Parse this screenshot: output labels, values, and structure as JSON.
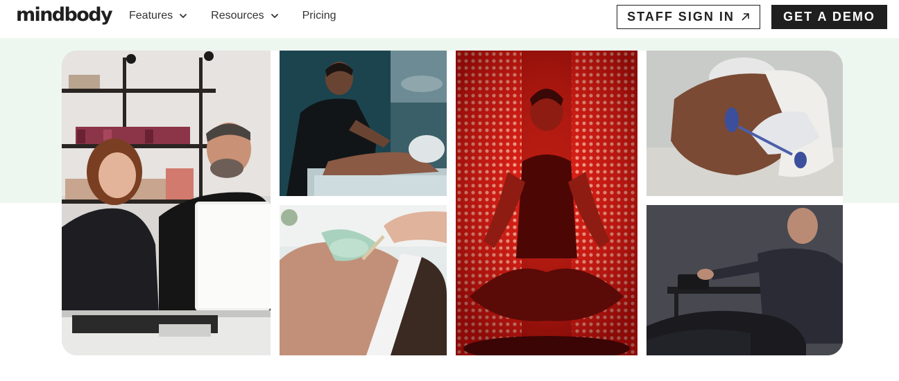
{
  "brand": {
    "logo_text": "mindbody"
  },
  "nav": {
    "items": [
      {
        "label": "Features",
        "has_dropdown": true
      },
      {
        "label": "Resources",
        "has_dropdown": true
      },
      {
        "label": "Pricing",
        "has_dropdown": false
      }
    ]
  },
  "header": {
    "staff_sign_in_label": "STAFF SIGN IN",
    "get_demo_label": "GET A DEMO"
  },
  "colors": {
    "brand_dark": "#1f1f1f",
    "hero_band": "#edf7ef",
    "red_light": "#e8241c"
  },
  "icons": {
    "nav_dropdown": "chevron-down-icon",
    "staff_sign_in": "arrow-up-right-icon"
  },
  "collage": {
    "photos": [
      "front-desk-staff-photo",
      "massage-therapy-photo",
      "red-light-meditation-photo",
      "facial-roller-photo",
      "facial-mask-photo",
      "compression-therapy-photo"
    ]
  }
}
